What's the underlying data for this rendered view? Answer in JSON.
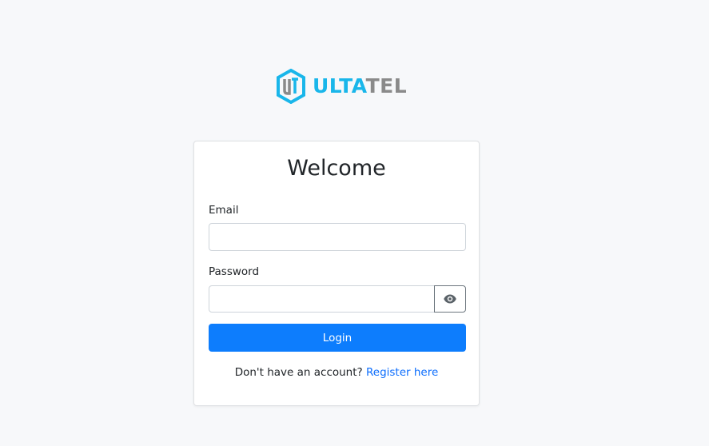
{
  "logo": {
    "text_part1": "ULTA",
    "text_part2": "TEL",
    "accent_color": "#19b6ea",
    "secondary_color": "#8a8a8a"
  },
  "card": {
    "title": "Welcome",
    "email_label": "Email",
    "email_value": "",
    "password_label": "Password",
    "password_value": "",
    "toggle_icon": "eye-icon",
    "login_label": "Login",
    "register_prompt": "Don't have an account?",
    "register_link": "Register here"
  },
  "colors": {
    "primary": "#0d7dfd",
    "background": "#f7f8fa"
  }
}
